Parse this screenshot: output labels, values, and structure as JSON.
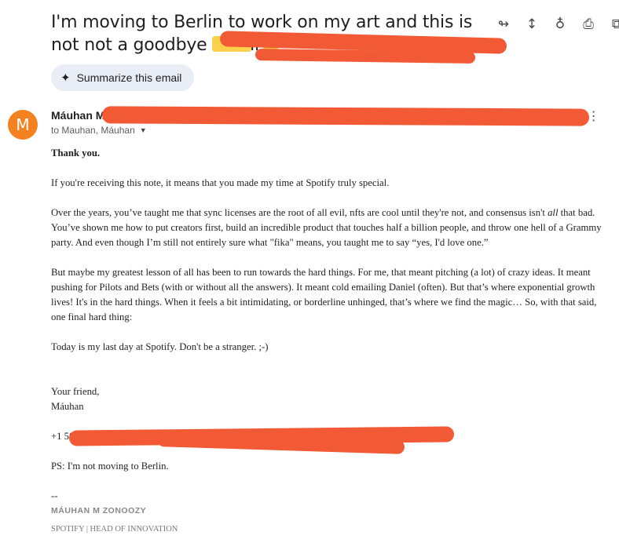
{
  "email": {
    "subject": "I'm moving to Berlin to work on my art and this is not not a goodbye email",
    "summarize_label": "Summarize this email",
    "sender_initial": "M",
    "sender_name": "Máuhan M",
    "to_line": "to Mauhan, Máuhan",
    "icons": [
      "forward-all-icon",
      "expand-icon",
      "lightbulb-icon",
      "print-icon",
      "open-in-new-icon",
      "star-icon",
      "reply-icon",
      "more-vert-icon"
    ],
    "body": {
      "greeting": "Thank you.",
      "p1": "If you're receiving this note, it means that you made my time at Spotify truly special.",
      "p2_a": "Over the years, you’ve taught me that sync licenses are the root of all evil, nfts are cool until they're not, and consensus isn't ",
      "p2_em": "all",
      "p2_b": " that bad. You’ve shown me how to put creators first, build an incredible product that touches half a billion people, and throw one hell of a Grammy party. And even though I’m still not entirely sure what \"fika\" means, you taught me to say “yes, I'd love one.”",
      "p3": "But maybe my greatest lesson of all has been to run towards the hard things. For me, that meant pitching (a lot) of crazy ideas. It meant pushing for Pilots and Bets (with or without all the answers). It meant cold emailing Daniel (often). But that’s where exponential growth lives! It's in the hard things. When it feels a bit intimidating, or borderline unhinged, that’s where we find the magic… So, with that said, one final hard thing:",
      "p4": "Today is my last day at Spotify. Don't be a stranger. ;-)",
      "closing": "Your friend,",
      "signoff": "Máuhan",
      "phone": "+1 50",
      "ps": "PS: I'm not moving to Berlin.",
      "sig_dash": "--",
      "sig_name": "MÁUHAN M ZONOOZY",
      "sig_title": "SPOTIFY | HEAD OF INNOVATION"
    }
  },
  "colors": {
    "avatar": "#f4811f",
    "redaction": "#f15a35",
    "chip": "#e9eef6"
  }
}
